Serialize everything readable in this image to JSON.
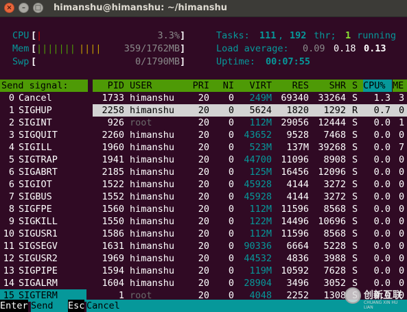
{
  "window": {
    "title": "himanshu@himanshu: ~/himanshu",
    "close_glyph": "×",
    "min_glyph": "–",
    "max_glyph": "□"
  },
  "meters": {
    "cpu": {
      "label": "CPU",
      "open": "[",
      "bar": "|",
      "value": "3.3%",
      "close": "]"
    },
    "mem": {
      "label": "Mem",
      "open": "[",
      "bar_green": "|||||||",
      "bar_yellow": "||||",
      "value": "359/1762MB",
      "close": "]"
    },
    "swp": {
      "label": "Swp",
      "open": "[",
      "value": "0/1790MB",
      "close": "]"
    },
    "tasks": {
      "label": "Tasks: ",
      "count": "111",
      "sep": ", ",
      "threads": "192",
      "thr_label": " thr; ",
      "running": "1",
      "running_label": " running"
    },
    "load": {
      "label": "Load average: ",
      "l1": "0.09",
      "l5": "0.18",
      "l15": "0.13"
    },
    "uptime": {
      "label": "Uptime: ",
      "value": "00:07:55"
    }
  },
  "signals": {
    "header": "Send signal:",
    "items": [
      {
        "num": "0",
        "name": "Cancel"
      },
      {
        "num": "1",
        "name": "SIGHUP"
      },
      {
        "num": "2",
        "name": "SIGINT"
      },
      {
        "num": "3",
        "name": "SIGQUIT"
      },
      {
        "num": "4",
        "name": "SIGILL"
      },
      {
        "num": "5",
        "name": "SIGTRAP"
      },
      {
        "num": "6",
        "name": "SIGABRT"
      },
      {
        "num": "6",
        "name": "SIGIOT"
      },
      {
        "num": "7",
        "name": "SIGBUS"
      },
      {
        "num": "8",
        "name": "SIGFPE"
      },
      {
        "num": "9",
        "name": "SIGKILL"
      },
      {
        "num": "10",
        "name": "SIGUSR1"
      },
      {
        "num": "11",
        "name": "SIGSEGV"
      },
      {
        "num": "12",
        "name": "SIGUSR2"
      },
      {
        "num": "13",
        "name": "SIGPIPE"
      },
      {
        "num": "14",
        "name": "SIGALRM"
      },
      {
        "num": "15",
        "name": "SIGTERM"
      }
    ]
  },
  "columns": {
    "pid": "PID",
    "user": "USER",
    "pri": "PRI",
    "ni": "NI",
    "virt": "VIRT",
    "res": "RES",
    "shr": "SHR",
    "s": "S",
    "cpu": "CPU%",
    "mem": "ME"
  },
  "processes": [
    {
      "pid": "1733",
      "user": "himanshu",
      "pri": "20",
      "ni": "0",
      "virt": "249M",
      "res": "69340",
      "shr": "33264",
      "s": "S",
      "cpu": "1.3",
      "mem": "3"
    },
    {
      "pid": "2258",
      "user": "himanshu",
      "pri": "20",
      "ni": "0",
      "virt": "5624",
      "res": "1820",
      "shr": "1292",
      "s": "R",
      "cpu": "0.7",
      "mem": "0"
    },
    {
      "pid": "926",
      "user": "root",
      "pri": "20",
      "ni": "0",
      "virt": "112M",
      "res": "29056",
      "shr": "12444",
      "s": "S",
      "cpu": "0.0",
      "mem": "1"
    },
    {
      "pid": "2260",
      "user": "himanshu",
      "pri": "20",
      "ni": "0",
      "virt": "43652",
      "res": "9528",
      "shr": "7468",
      "s": "S",
      "cpu": "0.0",
      "mem": "0"
    },
    {
      "pid": "1960",
      "user": "himanshu",
      "pri": "20",
      "ni": "0",
      "virt": "523M",
      "res": "137M",
      "shr": "39268",
      "s": "S",
      "cpu": "0.0",
      "mem": "7"
    },
    {
      "pid": "1941",
      "user": "himanshu",
      "pri": "20",
      "ni": "0",
      "virt": "44700",
      "res": "11096",
      "shr": "8908",
      "s": "S",
      "cpu": "0.0",
      "mem": "0"
    },
    {
      "pid": "2185",
      "user": "himanshu",
      "pri": "20",
      "ni": "0",
      "virt": "125M",
      "res": "16456",
      "shr": "12096",
      "s": "S",
      "cpu": "0.0",
      "mem": "0"
    },
    {
      "pid": "1522",
      "user": "himanshu",
      "pri": "20",
      "ni": "0",
      "virt": "45928",
      "res": "4144",
      "shr": "3272",
      "s": "S",
      "cpu": "0.0",
      "mem": "0"
    },
    {
      "pid": "1552",
      "user": "himanshu",
      "pri": "20",
      "ni": "0",
      "virt": "45928",
      "res": "4144",
      "shr": "3272",
      "s": "S",
      "cpu": "0.0",
      "mem": "0"
    },
    {
      "pid": "1560",
      "user": "himanshu",
      "pri": "20",
      "ni": "0",
      "virt": "112M",
      "res": "11596",
      "shr": "8568",
      "s": "S",
      "cpu": "0.0",
      "mem": "0"
    },
    {
      "pid": "1550",
      "user": "himanshu",
      "pri": "20",
      "ni": "0",
      "virt": "122M",
      "res": "14496",
      "shr": "10696",
      "s": "S",
      "cpu": "0.0",
      "mem": "0"
    },
    {
      "pid": "1586",
      "user": "himanshu",
      "pri": "20",
      "ni": "0",
      "virt": "112M",
      "res": "11596",
      "shr": "8568",
      "s": "S",
      "cpu": "0.0",
      "mem": "0"
    },
    {
      "pid": "1631",
      "user": "himanshu",
      "pri": "20",
      "ni": "0",
      "virt": "90336",
      "res": "6664",
      "shr": "5228",
      "s": "S",
      "cpu": "0.0",
      "mem": "0"
    },
    {
      "pid": "1969",
      "user": "himanshu",
      "pri": "20",
      "ni": "0",
      "virt": "44532",
      "res": "4836",
      "shr": "3988",
      "s": "S",
      "cpu": "0.0",
      "mem": "0"
    },
    {
      "pid": "1594",
      "user": "himanshu",
      "pri": "20",
      "ni": "0",
      "virt": "119M",
      "res": "10592",
      "shr": "7628",
      "s": "S",
      "cpu": "0.0",
      "mem": "0"
    },
    {
      "pid": "1604",
      "user": "himanshu",
      "pri": "20",
      "ni": "0",
      "virt": "28904",
      "res": "3496",
      "shr": "3052",
      "s": "S",
      "cpu": "0.0",
      "mem": "0"
    },
    {
      "pid": "1",
      "user": "root",
      "pri": "20",
      "ni": "0",
      "virt": "4048",
      "res": "2252",
      "shr": "1308",
      "s": "S",
      "cpu": "0.0",
      "mem": "0"
    }
  ],
  "footer": {
    "enter_key": "Enter",
    "enter_label": "Send",
    "esc_key": "Esc",
    "esc_label": "Cancel"
  },
  "watermark": {
    "text": "创新互联",
    "sub": "CHUANG XIN HU LIAN"
  },
  "colors": {
    "background": "#300a24",
    "cyan": "#06989a",
    "green": "#4e9a06",
    "selected_row": "#d3d3d3",
    "titlebar": "#3c3b37"
  }
}
